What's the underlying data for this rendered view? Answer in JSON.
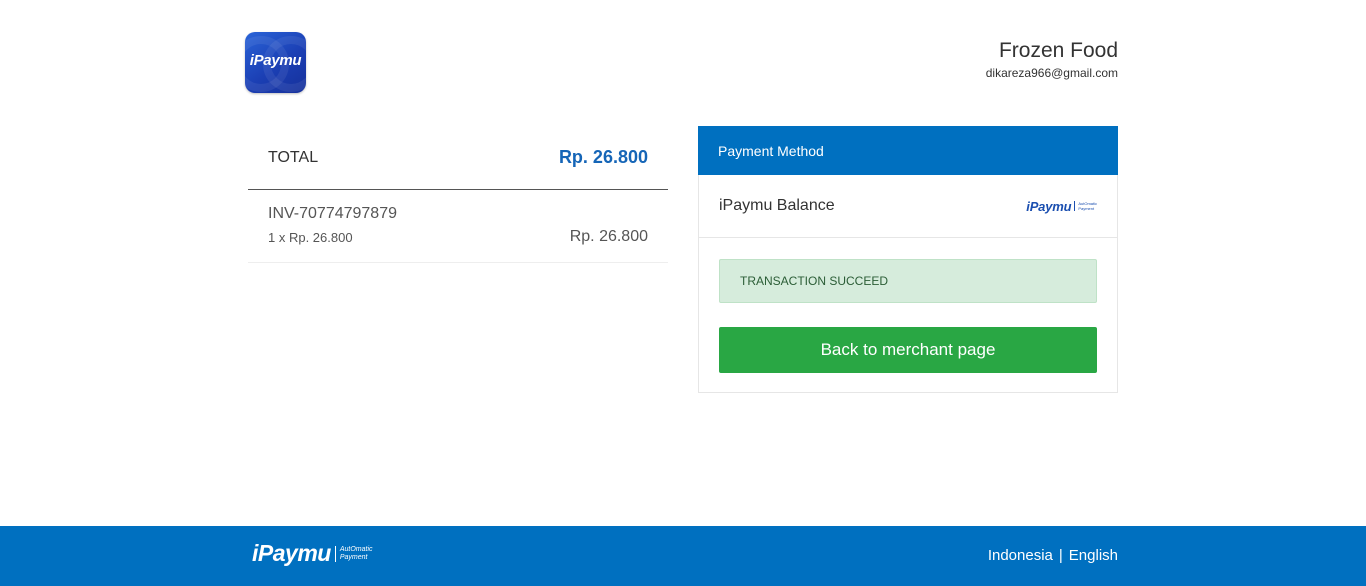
{
  "header": {
    "app_logo_text": "iPaymu",
    "merchant_name": "Frozen Food",
    "merchant_email": "dikareza966@gmail.com"
  },
  "summary": {
    "total_label": "TOTAL",
    "total_amount": "Rp. 26.800",
    "items": [
      {
        "invoice": "INV-70774797879",
        "qty_line": "1 x Rp. 26.800",
        "price": "Rp. 26.800"
      }
    ]
  },
  "payment": {
    "header": "Payment Method",
    "method_label": "iPaymu Balance",
    "method_logo_text": "iPaymu",
    "method_logo_tagline": [
      "AutOmatic",
      "Payment"
    ],
    "status": "TRANSACTION SUCCEED",
    "back_button": "Back to merchant page"
  },
  "footer": {
    "logo_text": "iPaymu",
    "logo_tagline": [
      "AutOmatic",
      "Payment"
    ],
    "lang_primary": "Indonesia",
    "lang_separator": "|",
    "lang_secondary": "English"
  },
  "colors": {
    "brand_blue": "#0070c0",
    "total_blue": "#1565b7",
    "success_green": "#29a744",
    "alert_bg": "#d6ecdc"
  }
}
